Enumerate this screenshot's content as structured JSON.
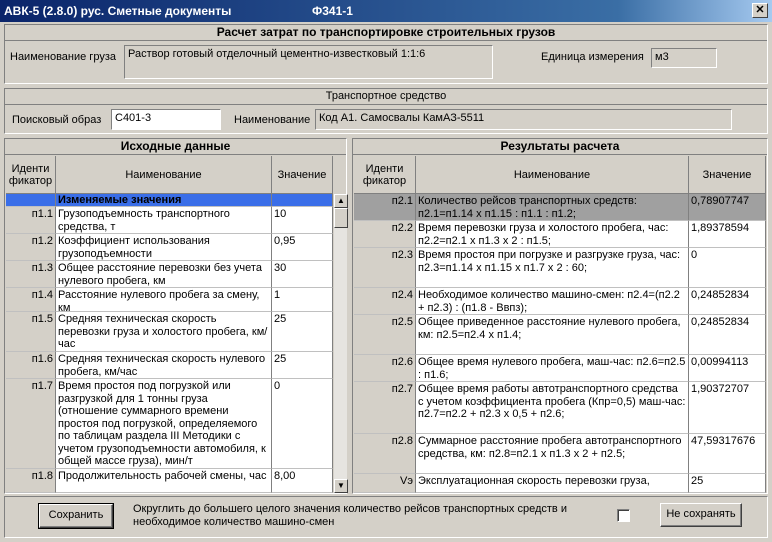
{
  "window": {
    "title_left": "АВК-5 (2.8.0)   рус.   Сметные документы",
    "title_right": "Ф341-1",
    "close_glyph": "✕"
  },
  "cargo": {
    "header": "Расчет затрат по транспортировке строительных грузов",
    "name_label": "Наименование груза",
    "name_value": "Раствор готовый отделочный цементно-известковый 1:1:6",
    "unit_label": "Единица измерения",
    "unit_value": "м3"
  },
  "transport": {
    "header": "Транспортное средство",
    "search_label": "Поисковый образ",
    "search_value": "С401-3",
    "name_label": "Наименование",
    "name_value": "Код А1. Самосвалы КамАЗ-5511"
  },
  "inputs": {
    "header": "Исходные данные",
    "col_id": "Иденти фикатор",
    "col_name": "Наименование",
    "col_value": "Значение",
    "rows": [
      {
        "id": "",
        "name": "Изменяемые значения",
        "value": ""
      },
      {
        "id": "п1.1",
        "name": "Грузоподъемность транспортного средства, т",
        "value": "10"
      },
      {
        "id": "п1.2",
        "name": "Коэффициент использования грузоподъемности",
        "value": "0,95"
      },
      {
        "id": "п1.3",
        "name": "Общее расстояние перевозки без учета нулевого пробега, км",
        "value": "30"
      },
      {
        "id": "п1.4",
        "name": "Расстояние нулевого пробега за смену, км",
        "value": "1"
      },
      {
        "id": "п1.5",
        "name": "Средняя техническая скорость перевозки груза и холостого пробега, км/час",
        "value": "25"
      },
      {
        "id": "п1.6",
        "name": "Средняя техническая скорость нулевого пробега, км/час",
        "value": "25"
      },
      {
        "id": "п1.7",
        "name": "Время простоя под погрузкой или разгрузкой для 1 тонны груза (отношение суммарного времени простоя под погрузкой, определяемого по таблицам раздела III Методики с учетом грузоподъемности автомобиля, к общей массе груза), мин/т",
        "value": "0"
      },
      {
        "id": "п1.8",
        "name": "Продолжительность рабочей смены, час",
        "value": "8,00"
      }
    ]
  },
  "results": {
    "header": "Результаты расчета",
    "col_id": "Иденти фикатор",
    "col_name": "Наименование",
    "col_value": "Значение",
    "rows": [
      {
        "id": "п2.1",
        "name": "Количество рейсов транспортных средств: п2.1=п1.14 x п1.15 : п1.1 : п1.2;",
        "value": "0,78907747"
      },
      {
        "id": "п2.2",
        "name": "Время перевозки груза и холостого пробега, час: п2.2=п2.1 x п1.3 x 2 : п1.5;",
        "value": "1,89378594"
      },
      {
        "id": "п2.3",
        "name": "Время простоя при погрузке и разгрузке груза, час: п2.3=п1.14 x п1.15 x п1.7 x 2 : 60;",
        "value": "0"
      },
      {
        "id": "п2.4",
        "name": "Необходимое количество машино-смен: п2.4=(п2.2 + п2.3) : (п1.8 - Ввпз);",
        "value": "0,24852834"
      },
      {
        "id": "п2.5",
        "name": "Общее приведенное расстояние нулевого пробега, км: п2.5=п2.4 x п1.4;",
        "value": "0,24852834"
      },
      {
        "id": "п2.6",
        "name": "Общее время нулевого пробега, маш-час: п2.6=п2.5 : п1.6;",
        "value": "0,00994113"
      },
      {
        "id": "п2.7",
        "name": "Общее время работы автотранспортного средства с учетом коэффициента пробега (Кпр=0,5) маш-час: п2.7=п2.2 + п2.3 x 0,5 + п2.6;",
        "value": "1,90372707"
      },
      {
        "id": "п2.8",
        "name": "Суммарное расстояние пробега автотранспортного средства, км: п2.8=п2.1 x п1.3 x 2 + п2.5;",
        "value": "47,59317676"
      },
      {
        "id": "Vэ",
        "name": "Эксплуатационная скорость перевозки груза,",
        "value": "25"
      }
    ]
  },
  "footer": {
    "save_label": "Сохранить",
    "round_text": "Округлить до большего целого значения количество рейсов транспортных средств и необходимое количество машино-смен",
    "nosave_label": "Не сохранять"
  },
  "colors": {
    "title_start": "#0a246a",
    "title_end": "#a6caf0",
    "selection_blue": "#3a6ee8",
    "selection_gray": "#a0a0a0"
  }
}
